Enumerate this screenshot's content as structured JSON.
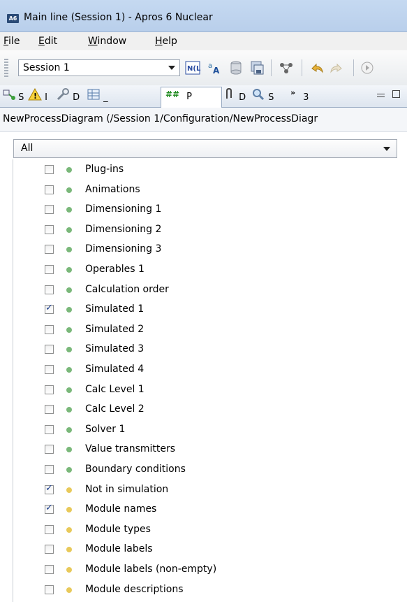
{
  "window": {
    "app_icon": "A6",
    "title": "Main line (Session 1) - Apros 6 Nuclear"
  },
  "menu": {
    "file": {
      "mnemonic": "F",
      "rest": "ile"
    },
    "edit": {
      "mnemonic": "E",
      "rest": "dit"
    },
    "window": {
      "mnemonic": "W",
      "rest": "indow"
    },
    "help": {
      "mnemonic": "H",
      "rest": "elp"
    }
  },
  "toolbar": {
    "session_value": "Session 1",
    "icons": [
      "n-lock-icon",
      "translate-icon",
      "database-icon",
      "save-as-icon",
      "network-icon",
      "undo-icon",
      "redo-icon",
      "run-icon"
    ]
  },
  "tabs": [
    {
      "icon": "model-browser-icon",
      "label": "S"
    },
    {
      "icon": "warning-icon",
      "label": "I"
    },
    {
      "icon": "wrench-icon",
      "label": "D"
    },
    {
      "icon": "table-icon",
      "label": "_"
    },
    {
      "icon": "hash-icon",
      "label": "P"
    },
    {
      "icon": "clip-icon",
      "label": "D"
    },
    {
      "icon": "search-icon",
      "label": "S"
    },
    {
      "icon": "overflow-icon",
      "label": "3"
    }
  ],
  "path": {
    "text": "NewProcessDiagram (/Session 1/Configuration/NewProcessDiagr"
  },
  "filter": {
    "value": "All"
  },
  "layers": [
    {
      "label": "Plug-ins",
      "checked": false,
      "dot": "#7ab87a"
    },
    {
      "label": "Animations",
      "checked": false,
      "dot": "#7ab87a"
    },
    {
      "label": "Dimensioning 1",
      "checked": false,
      "dot": "#7ab87a"
    },
    {
      "label": "Dimensioning 2",
      "checked": false,
      "dot": "#7ab87a"
    },
    {
      "label": "Dimensioning 3",
      "checked": false,
      "dot": "#7ab87a"
    },
    {
      "label": "Operables 1",
      "checked": false,
      "dot": "#7ab87a"
    },
    {
      "label": "Calculation order",
      "checked": false,
      "dot": "#7ab87a"
    },
    {
      "label": "Simulated 1",
      "checked": true,
      "dot": "#7ab87a"
    },
    {
      "label": "Simulated 2",
      "checked": false,
      "dot": "#7ab87a"
    },
    {
      "label": "Simulated 3",
      "checked": false,
      "dot": "#7ab87a"
    },
    {
      "label": "Simulated 4",
      "checked": false,
      "dot": "#7ab87a"
    },
    {
      "label": "Calc Level 1",
      "checked": false,
      "dot": "#7ab87a"
    },
    {
      "label": "Calc Level 2",
      "checked": false,
      "dot": "#7ab87a"
    },
    {
      "label": "Solver 1",
      "checked": false,
      "dot": "#7ab87a"
    },
    {
      "label": "Value transmitters",
      "checked": false,
      "dot": "#7ab87a"
    },
    {
      "label": "Boundary conditions",
      "checked": false,
      "dot": "#7ab87a"
    },
    {
      "label": "Not in simulation",
      "checked": true,
      "dot": "#e8c95a"
    },
    {
      "label": "Module names",
      "checked": true,
      "dot": "#e8c95a"
    },
    {
      "label": "Module types",
      "checked": false,
      "dot": "#e8c95a"
    },
    {
      "label": "Module labels",
      "checked": false,
      "dot": "#e8c95a"
    },
    {
      "label": "Module labels (non-empty)",
      "checked": false,
      "dot": "#e8c95a"
    },
    {
      "label": "Module descriptions",
      "checked": false,
      "dot": "#e8c95a"
    }
  ]
}
